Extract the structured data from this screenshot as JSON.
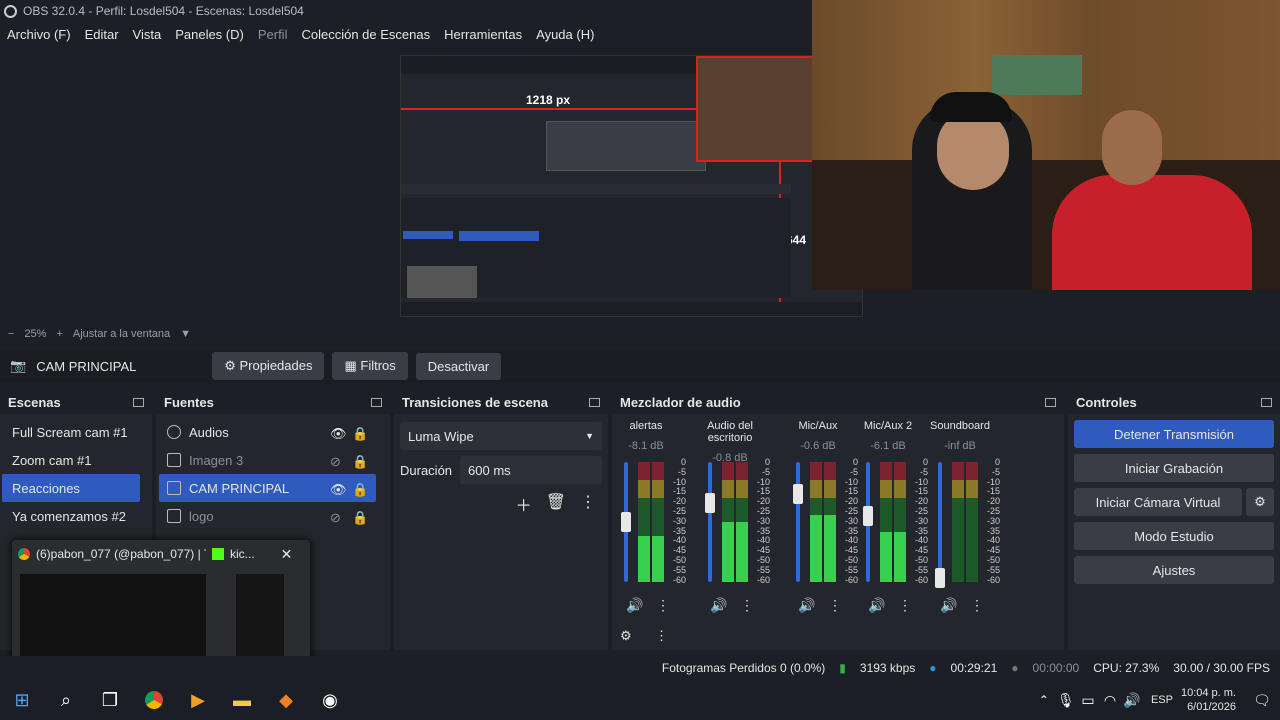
{
  "window": {
    "title": "OBS 32.0.4 - Perfil: Losdel504 - Escenas: Losdel504"
  },
  "menu": [
    "Archivo (F)",
    "Editar",
    "Vista",
    "Paneles (D)",
    "Perfil",
    "Colección de Escenas",
    "Herramientas",
    "Ayuda (H)"
  ],
  "preview": {
    "width_label": "1218 px",
    "height_label": "644"
  },
  "zoom": {
    "minus": "−",
    "value": "25%",
    "plus": "+",
    "fit": "Ajustar a la ventana"
  },
  "sourcebar": {
    "source": "CAM PRINCIPAL",
    "props": "Propiedades",
    "filters": "Filtros",
    "deactivate": "Desactivar"
  },
  "scenes": {
    "title": "Escenas",
    "items": [
      "Full Scream cam #1",
      "Zoom cam #1",
      "Reacciones",
      "Ya comenzamos #2"
    ],
    "selected": 2
  },
  "sources": {
    "title": "Fuentes",
    "items": [
      {
        "label": "Audios",
        "visible": true
      },
      {
        "label": "Imagen 3",
        "visible": false
      },
      {
        "label": "CAM PRINCIPAL",
        "visible": true
      },
      {
        "label": "logo",
        "visible": false
      }
    ],
    "selected": 2
  },
  "transitions": {
    "title": "Transiciones de escena",
    "type": "Luma Wipe",
    "duration_label": "Duración",
    "duration": "600 ms"
  },
  "mixer": {
    "title": "Mezclador de audio",
    "channels": [
      {
        "name": "alertas",
        "db": "-8.1 dB",
        "level": 0.55
      },
      {
        "name": "Audio del escritorio",
        "db": "-0.8 dB",
        "level": 0.72
      },
      {
        "name": "Mic/Aux",
        "db": "-0.6 dB",
        "level": 0.8
      },
      {
        "name": "Mic/Aux 2",
        "db": "-6.1 dB",
        "level": 0.6
      },
      {
        "name": "Soundboard",
        "db": "-inf dB",
        "level": 0.0
      }
    ],
    "scale": [
      "0",
      "-5",
      "-10",
      "-15",
      "-20",
      "-25",
      "-30",
      "-35",
      "-40",
      "-45",
      "-50",
      "-55",
      "-60"
    ]
  },
  "controls": {
    "title": "Controles",
    "buttons": [
      "Detener Transmisión",
      "Iniciar Grabación",
      "Iniciar Cámara Virtual",
      "Modo Estudio",
      "Ajustes"
    ]
  },
  "status": {
    "dropped": "Fotogramas Perdidos 0 (0.0%)",
    "bitrate": "3193 kbps",
    "stream_time": "00:29:21",
    "rec_time": "00:00:00",
    "cpu": "CPU: 27.3%",
    "fps": "30.00 / 30.00 FPS"
  },
  "popup": {
    "tab1": "(6)pabon_077 (@pabon_077) | T...",
    "tab2": "kic..."
  },
  "taskbar": {
    "lang": "ESP",
    "time": "10:04 p. m.",
    "date": "6/01/2026"
  },
  "colors": {
    "accent": "#2f5bbf",
    "bg": "#1d1f26",
    "panel": "#24262d"
  }
}
